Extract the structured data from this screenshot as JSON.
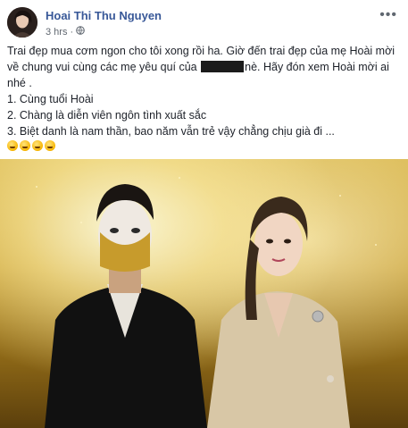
{
  "post": {
    "author": "Hoai Thi Thu Nguyen",
    "time": "3 hrs",
    "privacy_icon": "globe-icon",
    "more_icon": "ellipsis-icon",
    "lines": [
      "Trai đẹp mua cơm ngon cho tôi xong rồi ha. Giờ đến trai đẹp của mẹ Hoài mời",
      "về chung vui cùng các mẹ yêu quí của",
      "nè. Hãy đón xem Hoài mời ai",
      "nhé .",
      "1. Cùng tuổi Hoài",
      "2. Chàng là diễn viên ngôn tình xuất sắc",
      "3. Biệt danh là nam thần, bao năm vẫn trẻ vậy chẳng chịu già đi ..."
    ],
    "emoji_icons": [
      "thinking-emoji-icon",
      "smirk-emoji-icon",
      "thinking-emoji-icon",
      "laughing-emoji-icon"
    ]
  },
  "colors": {
    "author_link": "#385898",
    "meta_gray": "#606770",
    "text": "#1d2129",
    "photo_gold": "#c59a2b"
  }
}
